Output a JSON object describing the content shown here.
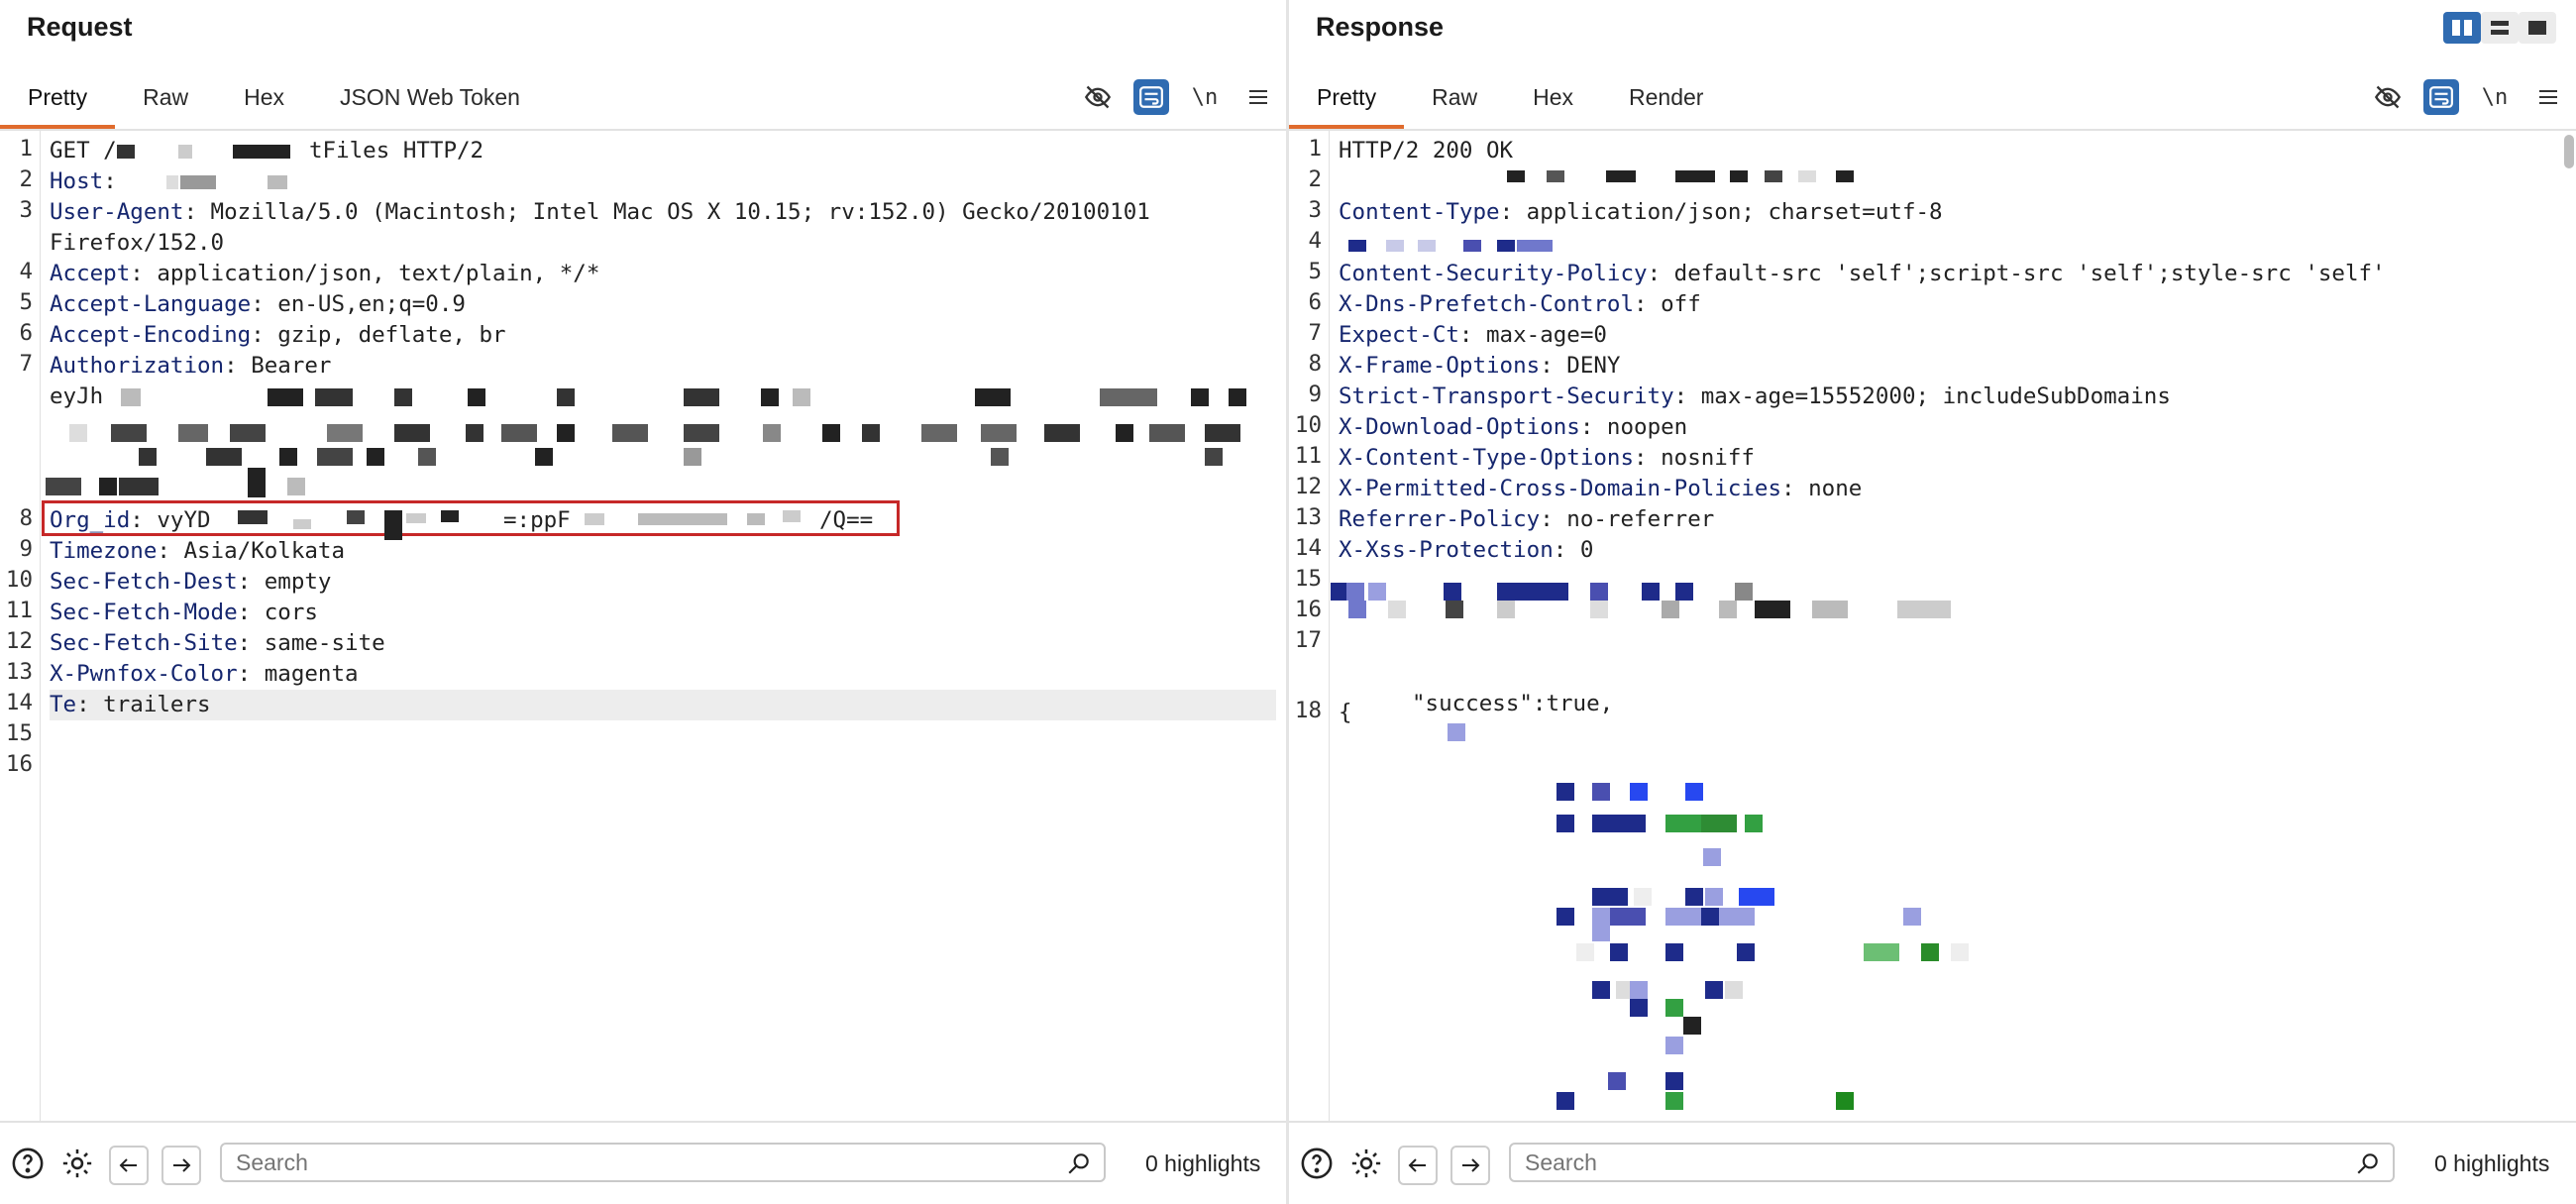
{
  "request": {
    "title": "Request",
    "tabs": [
      "Pretty",
      "Raw",
      "Hex",
      "JSON Web Token"
    ],
    "active_tab": "Pretty",
    "tools": [
      "hide-icon",
      "wrap-icon",
      "\\n",
      "menu-icon"
    ],
    "lines": [
      {
        "n": "1",
        "k": "",
        "v": "GET /"
      },
      {
        "n": "2",
        "k": "Host",
        "v": ":"
      },
      {
        "n": "3",
        "k": "User-Agent",
        "v": ": Mozilla/5.0 (Macintosh; Intel Mac OS X 10.15; rv:152.0) Gecko/20100101"
      },
      {
        "n": "",
        "k": "",
        "v": "Firefox/152.0"
      },
      {
        "n": "4",
        "k": "Accept",
        "v": ": application/json, text/plain, */*"
      },
      {
        "n": "5",
        "k": "Accept-Language",
        "v": ": en-US,en;q=0.9"
      },
      {
        "n": "6",
        "k": "Accept-Encoding",
        "v": ": gzip, deflate, br"
      },
      {
        "n": "7",
        "k": "Authorization",
        "v": ": Bearer"
      },
      {
        "n": "",
        "k": "",
        "v": "eyJh"
      },
      {
        "n": "8",
        "k": "Org_id",
        "v": ": vyYD"
      },
      {
        "n": "9",
        "k": "Timezone",
        "v": ": Asia/Kolkata"
      },
      {
        "n": "10",
        "k": "Sec-Fetch-Dest",
        "v": ": empty"
      },
      {
        "n": "11",
        "k": "Sec-Fetch-Mode",
        "v": ": cors"
      },
      {
        "n": "12",
        "k": "Sec-Fetch-Site",
        "v": ": same-site"
      },
      {
        "n": "13",
        "k": "X-Pwnfox-Color",
        "v": ": magenta"
      },
      {
        "n": "14",
        "k": "Te",
        "v": ": trailers"
      },
      {
        "n": "15",
        "k": "",
        "v": ""
      },
      {
        "n": "16",
        "k": "",
        "v": ""
      }
    ],
    "fragments": {
      "line1_tail": "tFiles HTTP/2",
      "org_mid": "=:ppF",
      "org_tail": "/Q=="
    },
    "search_placeholder": "Search",
    "highlights": "0 highlights"
  },
  "response": {
    "title": "Response",
    "tabs": [
      "Pretty",
      "Raw",
      "Hex",
      "Render"
    ],
    "active_tab": "Pretty",
    "lines": [
      {
        "n": "1",
        "k": "",
        "v": "HTTP/2 200 OK"
      },
      {
        "n": "2",
        "k": "",
        "v": ""
      },
      {
        "n": "3",
        "k": "Content-Type",
        "v": ": application/json; charset=utf-8"
      },
      {
        "n": "4",
        "k": "",
        "v": ""
      },
      {
        "n": "5",
        "k": "Content-Security-Policy",
        "v": ": default-src 'self';script-src 'self';style-src 'self'"
      },
      {
        "n": "6",
        "k": "X-Dns-Prefetch-Control",
        "v": ": off"
      },
      {
        "n": "7",
        "k": "Expect-Ct",
        "v": ": max-age=0"
      },
      {
        "n": "8",
        "k": "X-Frame-Options",
        "v": ": DENY"
      },
      {
        "n": "9",
        "k": "Strict-Transport-Security",
        "v": ": max-age=15552000; includeSubDomains"
      },
      {
        "n": "10",
        "k": "X-Download-Options",
        "v": ": noopen"
      },
      {
        "n": "11",
        "k": "X-Content-Type-Options",
        "v": ": nosniff"
      },
      {
        "n": "12",
        "k": "X-Permitted-Cross-Domain-Policies",
        "v": ": none"
      },
      {
        "n": "13",
        "k": "Referrer-Policy",
        "v": ": no-referrer"
      },
      {
        "n": "14",
        "k": "X-Xss-Protection",
        "v": ": 0"
      },
      {
        "n": "15",
        "k": "",
        "v": ""
      },
      {
        "n": "16",
        "k": "",
        "v": ""
      },
      {
        "n": "17",
        "k": "",
        "v": ""
      },
      {
        "n": "18",
        "k": "",
        "v": "{"
      }
    ],
    "json_line": "\"success\":true,",
    "search_placeholder": "Search",
    "highlights": "0 highlights"
  },
  "colors": {
    "accent": "#e06b2d",
    "toggle": "#2f6bb1",
    "header_key": "#15266e",
    "redbox": "#c62828"
  }
}
